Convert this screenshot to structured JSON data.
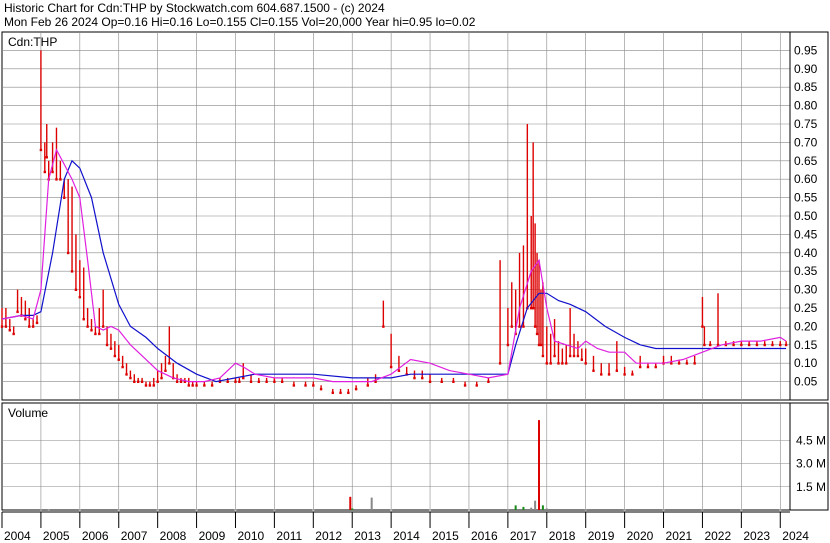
{
  "header": {
    "line1": "Historic Chart for Cdn:THP by Stockwatch.com 604.687.1500 - (c) 2024",
    "line2": "Mon Feb 26 2024   Op=0.16  Hi=0.16  Lo=0.155  Cl=0.155  Vol=20,000  Year hi=0.95  lo=0.02"
  },
  "colors": {
    "price_bars": "#dd0000",
    "ma_short": "#e020e0",
    "ma_long": "#1010cc",
    "volume_up": "#dd0000",
    "volume_down": "#1a8a1a",
    "volume_other": "#888888",
    "grid": "#888888",
    "frame": "#000000"
  },
  "chart_data": [
    {
      "type": "line",
      "symbol_label": "Cdn:THP",
      "yaxis_side": "right",
      "ylim": [
        0,
        1.0
      ],
      "yticks": [
        "0.05",
        "0.10",
        "0.15",
        "0.20",
        "0.25",
        "0.30",
        "0.35",
        "0.40",
        "0.45",
        "0.50",
        "0.55",
        "0.60",
        "0.65",
        "0.70",
        "0.75",
        "0.80",
        "0.85",
        "0.90",
        "0.95"
      ],
      "xlim": [
        2004.0,
        2024.25
      ],
      "grid": true,
      "series": [
        {
          "role": "price-hi-lo-bars",
          "x": [
            2004.0,
            2004.1,
            2004.2,
            2004.3,
            2004.4,
            2004.5,
            2004.6,
            2004.7,
            2004.8,
            2004.9,
            2005.0,
            2005.1,
            2005.15,
            2005.2,
            2005.3,
            2005.4,
            2005.5,
            2005.6,
            2005.7,
            2005.8,
            2005.9,
            2006.0,
            2006.1,
            2006.2,
            2006.3,
            2006.4,
            2006.5,
            2006.6,
            2006.7,
            2006.8,
            2006.9,
            2007.0,
            2007.1,
            2007.2,
            2007.3,
            2007.4,
            2007.5,
            2007.6,
            2007.7,
            2007.8,
            2007.9,
            2008.0,
            2008.1,
            2008.2,
            2008.3,
            2008.4,
            2008.5,
            2008.6,
            2008.7,
            2008.8,
            2008.9,
            2009.0,
            2009.2,
            2009.4,
            2009.6,
            2009.8,
            2010.0,
            2010.1,
            2010.2,
            2010.4,
            2010.6,
            2010.8,
            2011.0,
            2011.2,
            2011.5,
            2011.8,
            2012.0,
            2012.2,
            2012.5,
            2012.7,
            2012.9,
            2013.1,
            2013.4,
            2013.6,
            2013.8,
            2014.0,
            2014.2,
            2014.4,
            2014.6,
            2014.8,
            2015.0,
            2015.3,
            2015.6,
            2015.9,
            2016.2,
            2016.5,
            2016.8,
            2017.0,
            2017.1,
            2017.2,
            2017.3,
            2017.4,
            2017.5,
            2017.6,
            2017.65,
            2017.7,
            2017.75,
            2017.8,
            2017.85,
            2017.9,
            2018.0,
            2018.1,
            2018.2,
            2018.3,
            2018.4,
            2018.5,
            2018.6,
            2018.7,
            2018.8,
            2018.9,
            2019.0,
            2019.2,
            2019.4,
            2019.6,
            2019.8,
            2020.0,
            2020.2,
            2020.4,
            2020.6,
            2020.8,
            2021.0,
            2021.2,
            2021.4,
            2021.6,
            2021.8,
            2022.0,
            2022.05,
            2022.2,
            2022.4,
            2022.6,
            2022.8,
            2023.0,
            2023.2,
            2023.4,
            2023.6,
            2023.8,
            2024.0,
            2024.15
          ],
          "hi": [
            0.25,
            0.25,
            0.22,
            0.2,
            0.3,
            0.28,
            0.27,
            0.25,
            0.22,
            0.23,
            0.95,
            0.7,
            0.75,
            0.65,
            0.7,
            0.74,
            0.65,
            0.6,
            0.6,
            0.58,
            0.45,
            0.38,
            0.36,
            0.25,
            0.22,
            0.2,
            0.25,
            0.3,
            0.2,
            0.18,
            0.16,
            0.15,
            0.12,
            0.1,
            0.08,
            0.07,
            0.06,
            0.06,
            0.05,
            0.05,
            0.06,
            0.08,
            0.1,
            0.12,
            0.2,
            0.1,
            0.07,
            0.06,
            0.06,
            0.06,
            0.05,
            0.05,
            0.05,
            0.05,
            0.06,
            0.06,
            0.06,
            0.06,
            0.1,
            0.07,
            0.06,
            0.06,
            0.06,
            0.06,
            0.05,
            0.05,
            0.05,
            0.04,
            0.03,
            0.03,
            0.03,
            0.04,
            0.06,
            0.07,
            0.27,
            0.18,
            0.12,
            0.09,
            0.08,
            0.08,
            0.07,
            0.06,
            0.06,
            0.05,
            0.05,
            0.06,
            0.38,
            0.25,
            0.32,
            0.3,
            0.4,
            0.42,
            0.75,
            0.5,
            0.7,
            0.48,
            0.4,
            0.38,
            0.3,
            0.32,
            0.2,
            0.18,
            0.22,
            0.16,
            0.14,
            0.15,
            0.25,
            0.18,
            0.16,
            0.14,
            0.14,
            0.12,
            0.1,
            0.1,
            0.16,
            0.09,
            0.08,
            0.12,
            0.1,
            0.1,
            0.12,
            0.12,
            0.11,
            0.11,
            0.12,
            0.28,
            0.2,
            0.16,
            0.29,
            0.16,
            0.16,
            0.16,
            0.16,
            0.16,
            0.16,
            0.16,
            0.16,
            0.16
          ],
          "lo": [
            0.2,
            0.2,
            0.19,
            0.18,
            0.24,
            0.23,
            0.22,
            0.2,
            0.2,
            0.21,
            0.68,
            0.62,
            0.66,
            0.6,
            0.62,
            0.6,
            0.6,
            0.55,
            0.4,
            0.35,
            0.3,
            0.28,
            0.22,
            0.2,
            0.19,
            0.18,
            0.18,
            0.2,
            0.15,
            0.14,
            0.12,
            0.11,
            0.09,
            0.07,
            0.06,
            0.05,
            0.05,
            0.05,
            0.04,
            0.04,
            0.04,
            0.05,
            0.06,
            0.08,
            0.1,
            0.06,
            0.05,
            0.05,
            0.05,
            0.04,
            0.04,
            0.04,
            0.04,
            0.04,
            0.05,
            0.05,
            0.05,
            0.05,
            0.06,
            0.05,
            0.05,
            0.05,
            0.05,
            0.05,
            0.04,
            0.04,
            0.04,
            0.03,
            0.02,
            0.02,
            0.02,
            0.03,
            0.04,
            0.05,
            0.2,
            0.09,
            0.08,
            0.07,
            0.06,
            0.06,
            0.05,
            0.05,
            0.05,
            0.04,
            0.04,
            0.05,
            0.1,
            0.15,
            0.2,
            0.18,
            0.2,
            0.2,
            0.25,
            0.25,
            0.25,
            0.2,
            0.18,
            0.15,
            0.15,
            0.12,
            0.1,
            0.1,
            0.12,
            0.1,
            0.1,
            0.1,
            0.12,
            0.12,
            0.12,
            0.11,
            0.1,
            0.08,
            0.07,
            0.07,
            0.08,
            0.07,
            0.07,
            0.09,
            0.09,
            0.09,
            0.1,
            0.1,
            0.1,
            0.1,
            0.1,
            0.2,
            0.15,
            0.15,
            0.15,
            0.15,
            0.15,
            0.15,
            0.15,
            0.15,
            0.15,
            0.15,
            0.15,
            0.15
          ]
        },
        {
          "role": "moving-average-short",
          "x": [
            2004.0,
            2004.5,
            2004.8,
            2005.0,
            2005.2,
            2005.4,
            2005.6,
            2005.8,
            2006.0,
            2006.2,
            2006.4,
            2006.6,
            2006.8,
            2007.0,
            2007.3,
            2007.6,
            2008.0,
            2008.4,
            2008.8,
            2009.2,
            2009.6,
            2010.0,
            2010.2,
            2010.5,
            2011.0,
            2011.5,
            2012.0,
            2012.5,
            2013.0,
            2013.5,
            2014.0,
            2014.5,
            2015.0,
            2015.5,
            2016.0,
            2016.5,
            2017.0,
            2017.3,
            2017.6,
            2017.8,
            2018.0,
            2018.2,
            2018.5,
            2018.8,
            2019.0,
            2019.3,
            2019.6,
            2020.0,
            2020.3,
            2020.6,
            2021.0,
            2021.5,
            2022.0,
            2022.5,
            2023.0,
            2023.5,
            2024.0,
            2024.15
          ],
          "y": [
            0.22,
            0.23,
            0.22,
            0.3,
            0.6,
            0.68,
            0.64,
            0.6,
            0.55,
            0.38,
            0.2,
            0.19,
            0.2,
            0.19,
            0.15,
            0.12,
            0.08,
            0.06,
            0.05,
            0.05,
            0.06,
            0.1,
            0.09,
            0.07,
            0.06,
            0.06,
            0.06,
            0.05,
            0.05,
            0.05,
            0.07,
            0.11,
            0.1,
            0.08,
            0.07,
            0.06,
            0.07,
            0.25,
            0.35,
            0.38,
            0.25,
            0.16,
            0.15,
            0.14,
            0.16,
            0.14,
            0.13,
            0.13,
            0.1,
            0.1,
            0.1,
            0.11,
            0.13,
            0.15,
            0.16,
            0.16,
            0.17,
            0.16
          ]
        },
        {
          "role": "moving-average-long",
          "x": [
            2004.0,
            2004.5,
            2004.8,
            2005.0,
            2005.3,
            2005.6,
            2005.8,
            2006.0,
            2006.3,
            2006.6,
            2007.0,
            2007.3,
            2007.7,
            2008.0,
            2008.5,
            2009.0,
            2009.5,
            2010.0,
            2010.5,
            2011.0,
            2012.0,
            2013.0,
            2014.0,
            2014.5,
            2015.0,
            2016.0,
            2017.0,
            2017.2,
            2017.5,
            2017.8,
            2018.0,
            2018.3,
            2018.6,
            2019.0,
            2019.5,
            2020.0,
            2020.4,
            2020.8,
            2021.2,
            2021.6,
            2022.0,
            2022.5,
            2023.0,
            2023.5,
            2024.0,
            2024.15
          ],
          "y": [
            0.22,
            0.23,
            0.23,
            0.24,
            0.4,
            0.6,
            0.65,
            0.63,
            0.55,
            0.4,
            0.26,
            0.2,
            0.17,
            0.14,
            0.1,
            0.07,
            0.05,
            0.06,
            0.07,
            0.07,
            0.07,
            0.06,
            0.06,
            0.07,
            0.07,
            0.07,
            0.07,
            0.15,
            0.25,
            0.29,
            0.29,
            0.27,
            0.26,
            0.24,
            0.2,
            0.17,
            0.15,
            0.14,
            0.14,
            0.14,
            0.14,
            0.14,
            0.14,
            0.14,
            0.14,
            0.14
          ]
        }
      ]
    },
    {
      "type": "bar",
      "title": "Volume",
      "yaxis_side": "right",
      "ylim": [
        0,
        6.0
      ],
      "yticks": [
        "1.5 M",
        "3.0 M",
        "4.5 M"
      ],
      "grid": true,
      "x": [
        2005.0,
        2005.2,
        2006.0,
        2007.0,
        2008.0,
        2009.0,
        2010.0,
        2011.0,
        2012.0,
        2012.95,
        2013.0,
        2013.5,
        2014.0,
        2015.0,
        2016.0,
        2017.0,
        2017.2,
        2017.4,
        2017.6,
        2017.7,
        2017.8,
        2017.9,
        2018.0,
        2019.0,
        2020.0,
        2021.0,
        2022.0,
        2023.0,
        2024.0
      ],
      "values": [
        0.05,
        0.05,
        0.04,
        0.03,
        0.03,
        0.03,
        0.03,
        0.02,
        0.03,
        0.85,
        0.1,
        0.8,
        0.03,
        0.03,
        0.03,
        0.05,
        0.3,
        0.2,
        0.15,
        0.6,
        5.8,
        0.3,
        0.1,
        0.05,
        0.04,
        0.04,
        0.05,
        0.04,
        0.04
      ],
      "bar_color_role": [
        "other",
        "other",
        "other",
        "other",
        "other",
        "other",
        "other",
        "other",
        "other",
        "up",
        "down",
        "other",
        "other",
        "other",
        "other",
        "other",
        "down",
        "down",
        "other",
        "other",
        "up",
        "down",
        "other",
        "other",
        "other",
        "other",
        "other",
        "other",
        "other"
      ]
    }
  ],
  "xaxis": {
    "year_labels": [
      "2004",
      "2005",
      "2006",
      "2007",
      "2008",
      "2009",
      "2010",
      "2011",
      "2012",
      "2013",
      "2014",
      "2015",
      "2016",
      "2017",
      "2018",
      "2019",
      "2020",
      "2021",
      "2022",
      "2023",
      "2024"
    ]
  }
}
